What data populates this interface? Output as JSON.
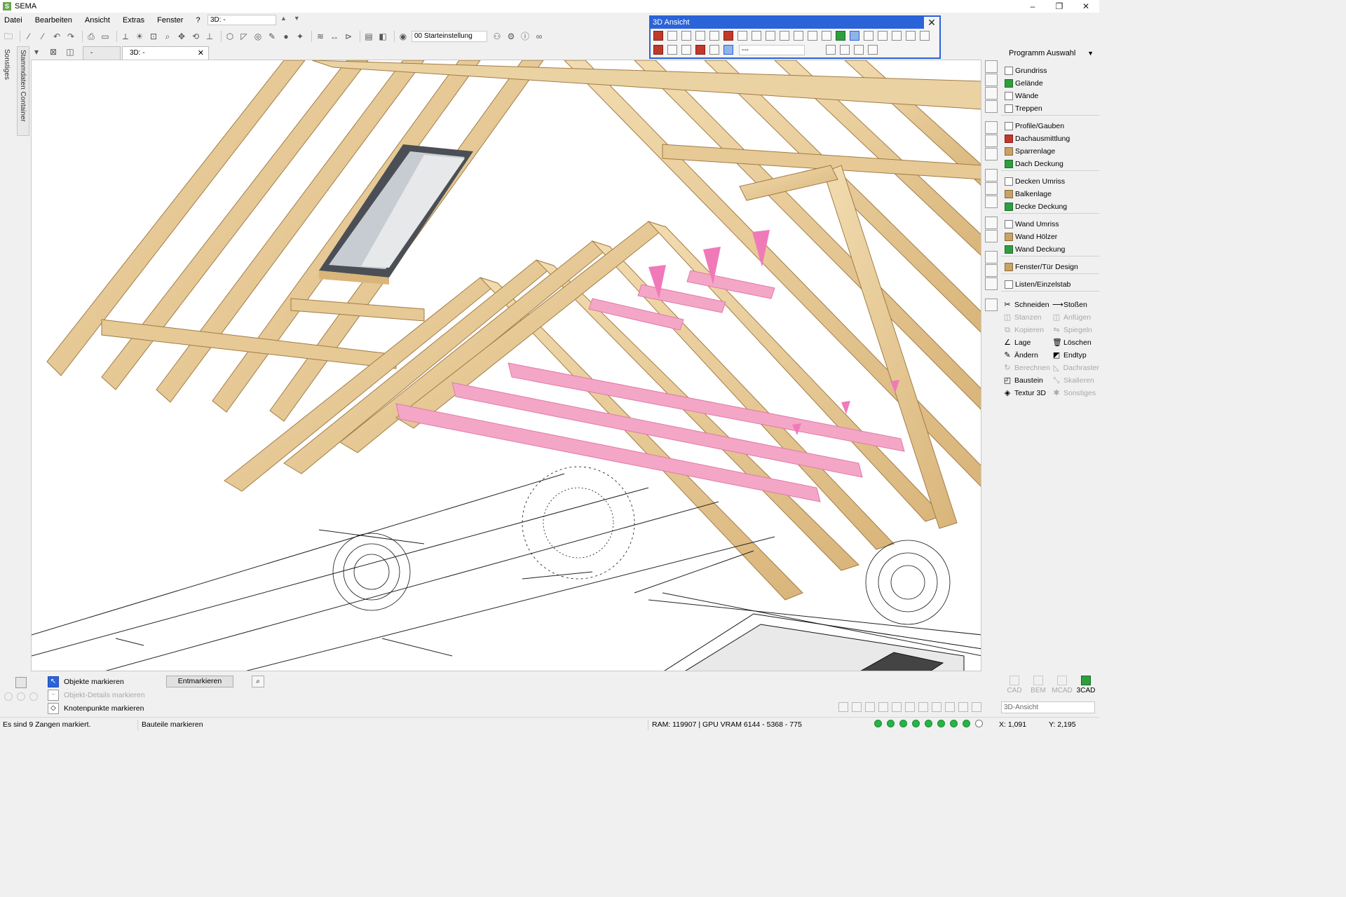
{
  "app": {
    "title": "SEMA"
  },
  "window_controls": {
    "minimize": "–",
    "maximize": "❐",
    "close": "✕"
  },
  "menu": {
    "items": [
      "Datei",
      "Bearbeiten",
      "Ansicht",
      "Extras",
      "Fenster",
      "?"
    ],
    "view_select": "3D: -"
  },
  "toolbar": {
    "start_setting": "00 Starteinstellung"
  },
  "tabs": [
    {
      "label": "-"
    },
    {
      "label": "3D: -"
    }
  ],
  "side": {
    "label_a": "Sonstiges",
    "label_b": "Stammdaten Container"
  },
  "panel_3d": {
    "title": "3D Ansicht",
    "field_value": "---"
  },
  "program_panel": {
    "header": "Programm Auswahl",
    "groups": [
      [
        {
          "label": "Grundriss",
          "icon": "plan-icon"
        },
        {
          "label": "Gelände",
          "icon": "terrain-icon"
        },
        {
          "label": "Wände",
          "icon": "wall-icon"
        },
        {
          "label": "Treppen",
          "icon": "stairs-icon"
        }
      ],
      [
        {
          "label": "Profile/Gauben",
          "icon": "profile-icon"
        },
        {
          "label": "Dachausmittlung",
          "icon": "roof-icon"
        },
        {
          "label": "Sparrenlage",
          "icon": "rafter-icon"
        },
        {
          "label": "Dach Deckung",
          "icon": "roof-cover-icon"
        }
      ],
      [
        {
          "label": "Decken Umriss",
          "icon": "ceiling-outline-icon"
        },
        {
          "label": "Balkenlage",
          "icon": "beam-icon"
        },
        {
          "label": "Decke Deckung",
          "icon": "ceiling-cover-icon"
        }
      ],
      [
        {
          "label": "Wand Umriss",
          "icon": "wall-outline-icon"
        },
        {
          "label": "Wand Hölzer",
          "icon": "wall-timber-icon"
        },
        {
          "label": "Wand Deckung",
          "icon": "wall-cover-icon"
        }
      ],
      [
        {
          "label": "Fenster/Tür Design",
          "icon": "window-door-icon"
        }
      ],
      [
        {
          "label": "Listen/Einzelstab",
          "icon": "list-icon"
        }
      ]
    ],
    "tools": [
      {
        "label": "Schneiden",
        "glyph": "✂",
        "enabled": true
      },
      {
        "label": "Stoßen",
        "glyph": "⟶",
        "enabled": true
      },
      {
        "label": "Stanzen",
        "glyph": "◫",
        "enabled": false
      },
      {
        "label": "Anfügen",
        "glyph": "◫",
        "enabled": false
      },
      {
        "label": "Kopieren",
        "glyph": "⧉",
        "enabled": false
      },
      {
        "label": "Spiegeln",
        "glyph": "⇋",
        "enabled": false
      },
      {
        "label": "Lage",
        "glyph": "∠",
        "enabled": true
      },
      {
        "label": "Löschen",
        "glyph": "🗑",
        "enabled": true
      },
      {
        "label": "Ändern",
        "glyph": "✎",
        "enabled": true
      },
      {
        "label": "Endtyp",
        "glyph": "◩",
        "enabled": true
      },
      {
        "label": "Berechnen",
        "glyph": "↻",
        "enabled": false
      },
      {
        "label": "Dachraster",
        "glyph": "◺",
        "enabled": false
      },
      {
        "label": "Baustein",
        "glyph": "◰",
        "enabled": true
      },
      {
        "label": "Skalieren",
        "glyph": "⤡",
        "enabled": false
      },
      {
        "label": "Textur 3D",
        "glyph": "◈",
        "enabled": true
      },
      {
        "label": "Sonstiges",
        "glyph": "✱",
        "enabled": false
      }
    ]
  },
  "bottom": {
    "mark_options": [
      {
        "label": "Objekte markieren",
        "active": true,
        "enabled": true
      },
      {
        "label": "Objekt-Details markieren",
        "active": false,
        "enabled": false
      },
      {
        "label": "Knotenpunkte markieren",
        "active": false,
        "enabled": true
      }
    ],
    "unmark_button": "Entmarkieren",
    "modes": [
      {
        "label": "CAD",
        "active": false
      },
      {
        "label": "BEM",
        "active": false
      },
      {
        "label": "MCAD",
        "active": false
      },
      {
        "label": "3CAD",
        "active": true
      }
    ],
    "view_combo": "3D-Ansicht"
  },
  "status": {
    "message": "Es sind 9 Zangen markiert.",
    "mode": "Bauteile markieren",
    "memory": "RAM: 119907 | GPU VRAM 6144 - 5368 - 775",
    "x": "X: 1,091",
    "y": "Y: 2,195"
  },
  "colors": {
    "accent": "#2b63d8",
    "wood": "#e8cfa0",
    "selected": "#f4a6c6",
    "status_ok": "#27b445"
  }
}
